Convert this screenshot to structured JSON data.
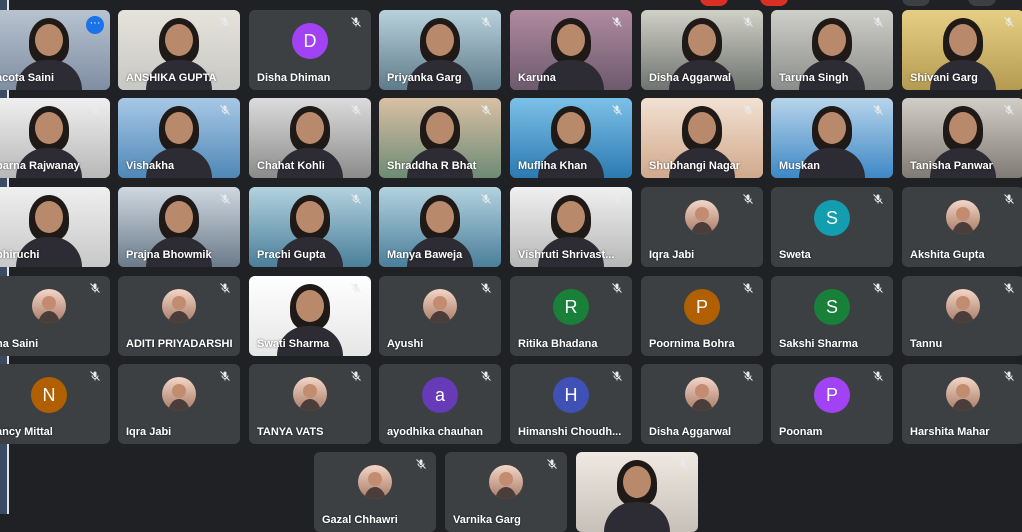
{
  "colors": {
    "background": "#202124",
    "tile": "#3c4043",
    "accent_blue": "#1a73e8"
  },
  "participants_rows": [
    [
      {
        "name": "acota Saini",
        "type": "video",
        "more": true
      },
      {
        "name": "ANSHIKA GUPTA",
        "type": "video"
      },
      {
        "name": "Disha Dhiman",
        "type": "avatar",
        "initial": "D",
        "color": "#a142f4"
      },
      {
        "name": "Priyanka Garg",
        "type": "video"
      },
      {
        "name": "Karuna",
        "type": "video"
      },
      {
        "name": "Disha Aggarwal",
        "type": "video"
      },
      {
        "name": "Taruna Singh",
        "type": "video"
      },
      {
        "name": "Shivani Garg",
        "type": "video"
      }
    ],
    [
      {
        "name": "parna Rajwanay",
        "type": "video"
      },
      {
        "name": "Vishakha",
        "type": "video"
      },
      {
        "name": "Chahat Kohli",
        "type": "video"
      },
      {
        "name": "Shraddha R Bhat",
        "type": "video"
      },
      {
        "name": "Mufliha Khan",
        "type": "video"
      },
      {
        "name": "Shubhangi Nagar",
        "type": "video"
      },
      {
        "name": "Muskan",
        "type": "video"
      },
      {
        "name": "Tanisha Panwar",
        "type": "video"
      }
    ],
    [
      {
        "name": "bhiruchi",
        "type": "video"
      },
      {
        "name": "Prajna Bhowmik",
        "type": "video"
      },
      {
        "name": "Prachi Gupta",
        "type": "video"
      },
      {
        "name": "Manya Baweja",
        "type": "video"
      },
      {
        "name": "Vishruti Shrivast...",
        "type": "video"
      },
      {
        "name": "Iqra Jabi",
        "type": "photo"
      },
      {
        "name": "Sweta",
        "type": "avatar",
        "initial": "S",
        "color": "#129eaf"
      },
      {
        "name": "Akshita Gupta",
        "type": "photo"
      }
    ],
    [
      {
        "name": "ha Saini",
        "type": "photo"
      },
      {
        "name": "ADITI PRIYADARSHI",
        "type": "photo"
      },
      {
        "name": "Swati Sharma",
        "type": "video"
      },
      {
        "name": "Ayushi",
        "type": "photo"
      },
      {
        "name": "Ritika Bhadana",
        "type": "avatar",
        "initial": "R",
        "color": "#188038"
      },
      {
        "name": "Poornima Bohra",
        "type": "avatar",
        "initial": "P",
        "color": "#b06000"
      },
      {
        "name": "Sakshi Sharma",
        "type": "avatar",
        "initial": "S",
        "color": "#188038"
      },
      {
        "name": "Tannu",
        "type": "photo"
      }
    ],
    [
      {
        "name": "ancy Mittal",
        "type": "avatar",
        "initial": "N",
        "color": "#b06000"
      },
      {
        "name": "Iqra Jabi",
        "type": "photo"
      },
      {
        "name": "TANYA VATS",
        "type": "photo"
      },
      {
        "name": "ayodhika chauhan",
        "type": "avatar",
        "initial": "a",
        "color": "#673ab7"
      },
      {
        "name": "Himanshi Choudh...",
        "type": "avatar",
        "initial": "H",
        "color": "#3f51b5"
      },
      {
        "name": "Disha Aggarwal",
        "type": "photo"
      },
      {
        "name": "Poonam",
        "type": "avatar",
        "initial": "P",
        "color": "#a142f4"
      },
      {
        "name": "Harshita Mahar",
        "type": "photo"
      }
    ],
    [
      {
        "name": "Gazal Chhawri",
        "type": "photo"
      },
      {
        "name": "Varnika Garg",
        "type": "photo"
      },
      {
        "name": "",
        "type": "video"
      }
    ]
  ],
  "icons": {
    "muted": "mic-off-icon",
    "more": "more-options-icon"
  }
}
